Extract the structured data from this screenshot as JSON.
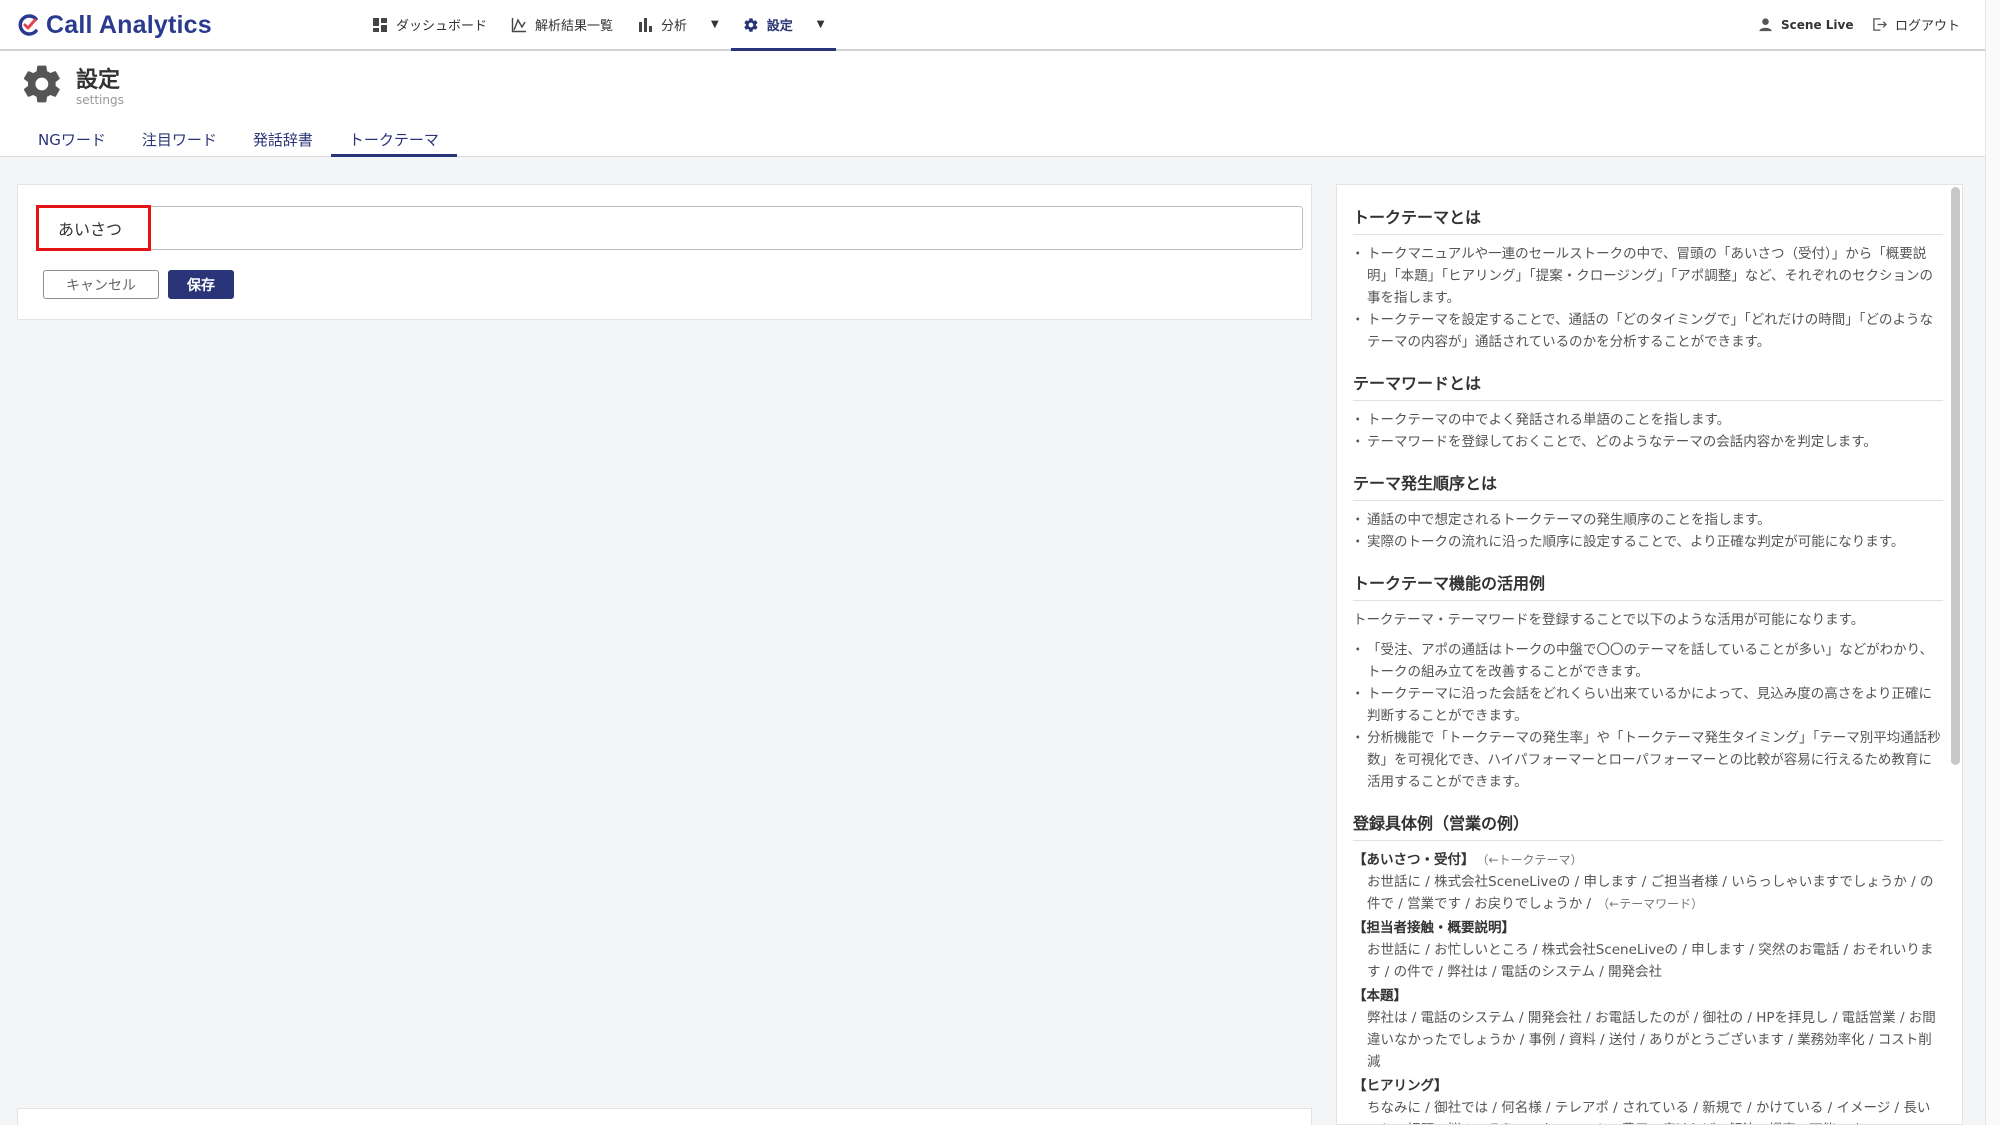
{
  "brand": {
    "name": "Call Analytics",
    "color": "#2a3a8f"
  },
  "nav": {
    "items": [
      {
        "label": "ダッシュボード",
        "icon": "dashboard-icon"
      },
      {
        "label": "解析結果一覧",
        "icon": "chart-line-icon"
      },
      {
        "label": "分析",
        "icon": "bar-chart-icon"
      },
      {
        "label": "設定",
        "icon": "gear-icon"
      }
    ],
    "user": "Scene Live",
    "logout": "ログアウト"
  },
  "page": {
    "title": "設定",
    "subtitle": "settings"
  },
  "tabs": [
    {
      "label": "NGワード"
    },
    {
      "label": "注目ワード"
    },
    {
      "label": "発話辞書"
    },
    {
      "label": "トークテーマ"
    }
  ],
  "form": {
    "input_value": "あいさつ",
    "cancel_label": "キャンセル",
    "save_label": "保存"
  },
  "help": {
    "s1": {
      "title": "トークテーマとは",
      "items": [
        "トークマニュアルや一連のセールストークの中で、冒頭の「あいさつ（受付）」から「概要説明」「本題」「ヒアリング」「提案・クロージング」「アポ調整」など、それぞれのセクションの事を指します。",
        "トークテーマを設定することで、通話の「どのタイミングで」「どれだけの時間」「どのようなテーマの内容が」通話されているのかを分析することができます。"
      ]
    },
    "s2": {
      "title": "テーマワードとは",
      "items": [
        "トークテーマの中でよく発話される単語のことを指します。",
        "テーマワードを登録しておくことで、どのようなテーマの会話内容かを判定します。"
      ]
    },
    "s3": {
      "title": "テーマ発生順序とは",
      "items": [
        "通話の中で想定されるトークテーマの発生順序のことを指します。",
        "実際のトークの流れに沿った順序に設定することで、より正確な判定が可能になります。"
      ]
    },
    "s4": {
      "title": "トークテーマ機能の活用例",
      "intro": "トークテーマ・テーマワードを登録することで以下のような活用が可能になります。",
      "items": [
        "「受注、アポの通話はトークの中盤で〇〇のテーマを話していることが多い」などがわかり、トークの組み立てを改善することができます。",
        "トークテーマに沿った会話をどれくらい出来ているかによって、見込み度の高さをより正確に判断することができます。",
        "分析機能で「トークテーマの発生率」や「トークテーマ発生タイミング」「テーマ別平均通話秒数」を可視化でき、ハイパフォーマーとローパフォーマーとの比較が容易に行えるため教育に活用することができます。"
      ]
    },
    "s5": {
      "title": "登録具体例（営業の例）",
      "ex1_head": "【あいさつ・受付】",
      "ex1_head_note": "（←トークテーマ）",
      "ex1_body": "お世話に / 株式会社SceneLiveの / 申します / ご担当者様 / いらっしゃいますでしょうか / の件で / 営業です / お戻りでしょうか /",
      "ex1_body_note": "（←テーマワード）",
      "ex2_head": "【担当者接触・概要説明】",
      "ex2_body": "お世話に / お忙しいところ / 株式会社SceneLiveの / 申します / 突然のお電話 / おそれいります / の件で / 弊社は / 電話のシステム / 開発会社",
      "ex3_head": "【本題】",
      "ex3_body": "弊社は / 電話のシステム / 開発会社 / お電話したのが / 御社の / HPを拝見し / 電話営業 / お間違いなかったでしょうか / 事例 / 資料 / 送付 / ありがとうございます / 業務効率化 / コスト削減",
      "ex4_head": "【ヒアリング】",
      "ex4_body": "ちなみに / 御社では / 何名様 / テレアポ / されている / 新規で / かけている / イメージ / 長いこと / 課題 / 悩み / そういった / コスト / 費用 / 痛ければ / 解決 / 提案 / 可能です"
    }
  }
}
